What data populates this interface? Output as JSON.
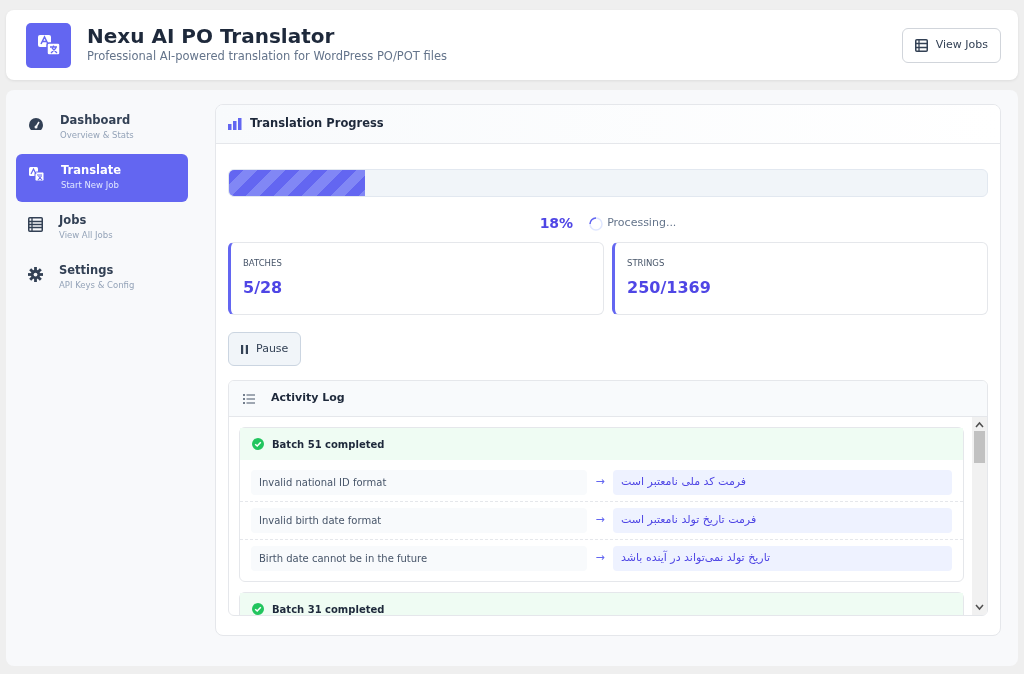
{
  "header": {
    "title": "Nexu AI PO Translator",
    "subtitle": "Professional AI-powered translation for WordPress PO/POT files",
    "button": "View Jobs"
  },
  "sidebar": {
    "items": [
      {
        "kind": "dashboard",
        "label": "Dashboard",
        "sublabel": "Overview & Stats",
        "selected": false
      },
      {
        "kind": "translate",
        "label": "Translate",
        "sublabel": "Start New Job",
        "selected": true
      },
      {
        "kind": "jobs",
        "label": "Jobs",
        "sublabel": "View All Jobs",
        "selected": false
      },
      {
        "kind": "settings",
        "label": "Settings",
        "sublabel": "API Keys & Config",
        "selected": false
      }
    ]
  },
  "progress": {
    "title": "Translation Progress",
    "level": 0.18,
    "percent": "18%",
    "status": "Processing...",
    "stats": [
      {
        "label": "BATCHES",
        "value": "5/28"
      },
      {
        "label": "STRINGS",
        "value": "250/1369"
      }
    ],
    "pause_button": "Pause"
  },
  "activity_log": {
    "title": "Activity Log",
    "batches": [
      {
        "title": "Batch 51 completed",
        "entries": [
          {
            "source": "Invalid national ID format",
            "arrow": "→",
            "target": "فرمت کد ملی نامعتبر است"
          },
          {
            "source": "Invalid birth date format",
            "arrow": "→",
            "target": "فرمت تاریخ تولد نامعتبر است"
          },
          {
            "source": "Birth date cannot be in the future",
            "arrow": "→",
            "target": "تاریخ تولد نمی‌تواند در آینده باشد"
          }
        ]
      },
      {
        "title": "Batch 31 completed"
      }
    ]
  }
}
